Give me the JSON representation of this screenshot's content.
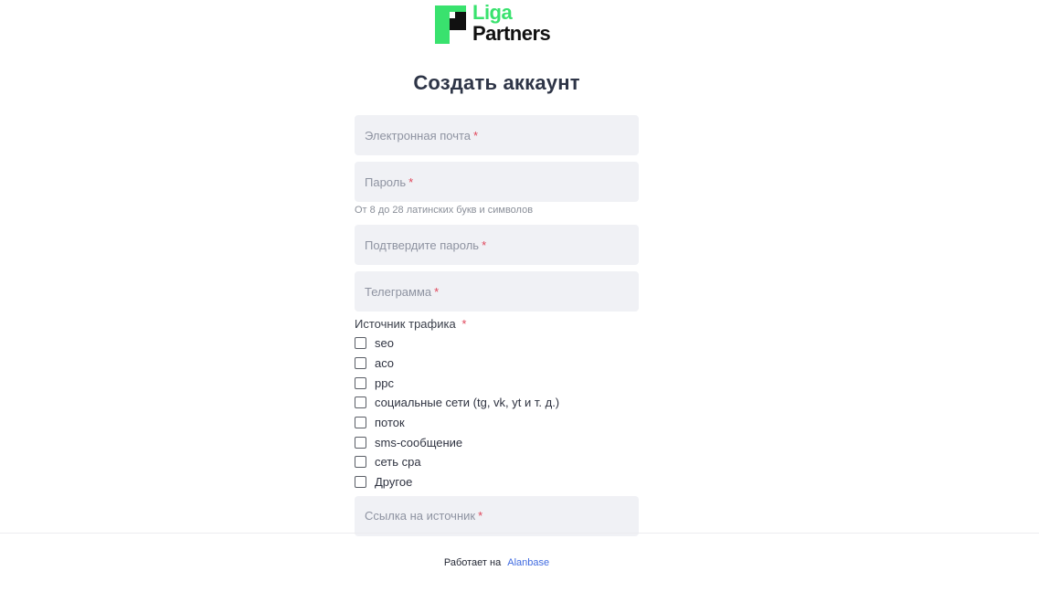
{
  "brand": {
    "line1": "Liga",
    "line2": "Partners",
    "accent_color": "#39e26e",
    "logo_icon": "liga-logo-mark-icon"
  },
  "page": {
    "title": "Создать аккаунт"
  },
  "form": {
    "required_mark": "*",
    "email": {
      "placeholder": "Электронная почта"
    },
    "password": {
      "placeholder": "Пароль",
      "hint": "От 8 до 28 латинских букв и символов"
    },
    "confirm_password": {
      "placeholder": "Подтвердите пароль"
    },
    "telegram": {
      "placeholder": "Телеграмма"
    },
    "traffic_source": {
      "label": "Источник трафика",
      "options": [
        "seo",
        "aco",
        "ppc",
        "социальные сети (tg, vk, yt и т. д.)",
        "поток",
        "sms-сообщение",
        "сеть cpa",
        "Другое"
      ]
    },
    "source_link": {
      "placeholder": "Ссылка на источник"
    }
  },
  "footer": {
    "prefix": "Работает на",
    "link": "Alanbase",
    "link_color": "#3f6ae0"
  }
}
